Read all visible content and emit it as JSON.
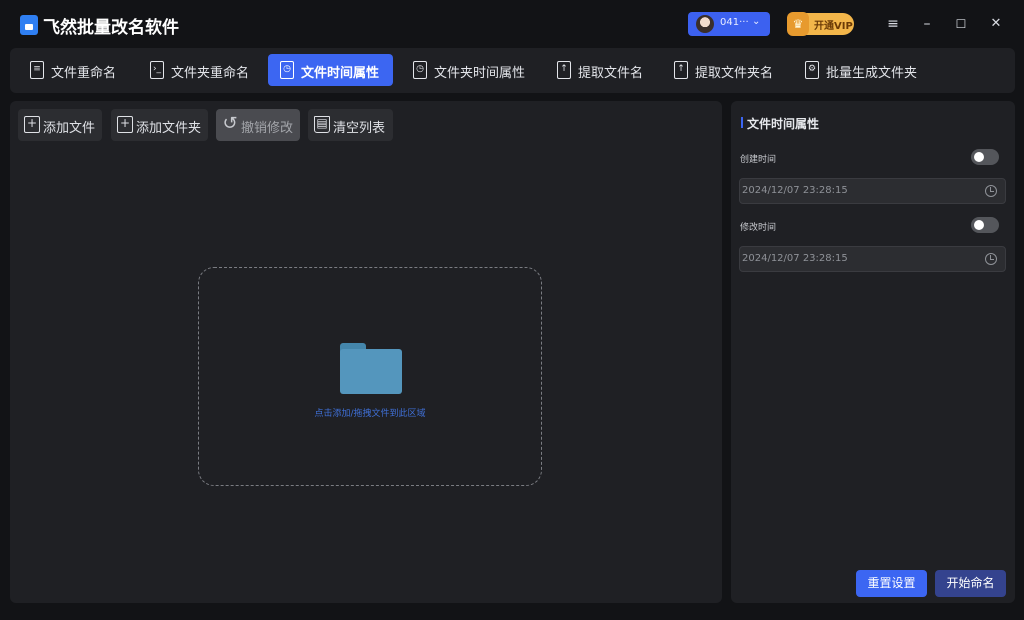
{
  "app": {
    "title": "飞然批量改名软件",
    "user": {
      "name": "041···",
      "chevron": "⌄"
    },
    "vip_label": "开通VIP",
    "window_controls": {
      "menu": "≡",
      "minimize": "–",
      "maximize": "☐",
      "close": "✕"
    }
  },
  "tabs": [
    {
      "label": "文件重命名",
      "icon": "file-rename-icon",
      "active": false
    },
    {
      "label": "文件夹重命名",
      "icon": "folder-rename-icon",
      "active": false
    },
    {
      "label": "文件时间属性",
      "icon": "file-time-icon",
      "active": true
    },
    {
      "label": "文件夹时间属性",
      "icon": "folder-time-icon",
      "active": false
    },
    {
      "label": "提取文件名",
      "icon": "extract-filename-icon",
      "active": false
    },
    {
      "label": "提取文件夹名",
      "icon": "extract-foldername-icon",
      "active": false
    },
    {
      "label": "批量生成文件夹",
      "icon": "batch-folder-icon",
      "active": false
    }
  ],
  "toolbar": {
    "add_file": "添加文件",
    "add_folder": "添加文件夹",
    "undo": "撤销修改",
    "clear": "清空列表"
  },
  "dropzone": {
    "hint": "点击添加/拖拽文件到此区域"
  },
  "panel": {
    "title": "文件时间属性",
    "created": {
      "label": "创建时间",
      "enabled": false,
      "value": "2024/12/07 23:28:15"
    },
    "modified": {
      "label": "修改时间",
      "enabled": false,
      "value": "2024/12/07 23:28:15"
    },
    "reset_label": "重置设置",
    "start_label": "开始命名"
  },
  "colors": {
    "accent": "#3c66f2",
    "background": "#121316",
    "panel": "#1f2024",
    "vip": "#f3b64a"
  }
}
